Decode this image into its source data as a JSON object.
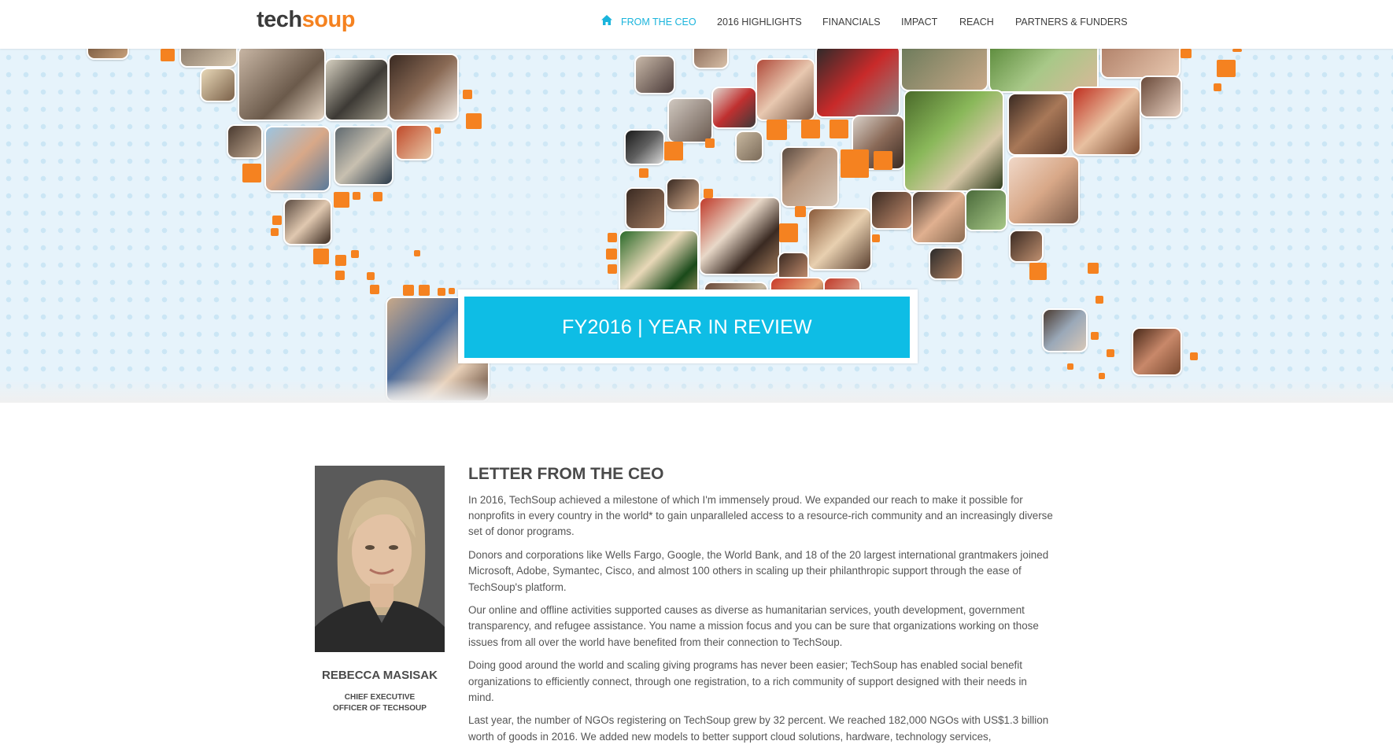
{
  "header": {
    "logo_part1": "tech",
    "logo_part2": "soup",
    "nav": [
      {
        "label": "FROM THE CEO",
        "active": true
      },
      {
        "label": "2016 HIGHLIGHTS"
      },
      {
        "label": "FINANCIALS"
      },
      {
        "label": "IMPACT"
      },
      {
        "label": "REACH"
      },
      {
        "label": "PARTNERS & FUNDERS"
      }
    ],
    "home_icon": "home-icon"
  },
  "hero": {
    "banner_text": "FY2016 | YEAR IN REVIEW",
    "colors": {
      "background": "#e6f3fb",
      "accent_square": "#f58220",
      "banner": "#0ebde5"
    }
  },
  "ceo": {
    "name": "REBECCA MASISAK",
    "title_line1": "CHIEF EXECUTIVE",
    "title_line2": "OFFICER OF TECHSOUP"
  },
  "letter": {
    "title": "LETTER FROM THE CEO",
    "paragraphs": [
      "In 2016, TechSoup achieved a milestone of which I'm immensely proud. We expanded our reach to make it possible for nonprofits in every country in the world* to gain unparalleled access to a resource-rich community and an increasingly diverse set of donor programs.",
      "Donors and corporations like Wells Fargo, Google, the World Bank, and 18 of the 20 largest international grantmakers joined Microsoft, Adobe, Symantec, Cisco, and almost 100 others in scaling up their philanthropic support through the ease of TechSoup's platform.",
      "Our online and offline activities supported causes as diverse as humanitarian services, youth development, government transparency, and refugee assistance. You name a mission focus and you can be sure that organizations working on those issues from all over the world have benefited from their connection to TechSoup.",
      "Doing good around the world and scaling giving programs has never been easier; TechSoup has enabled social benefit organizations to efficiently connect, through one registration, to a rich community of support designed with their needs in mind.",
      "Last year, the number of NGOs registering on TechSoup grew by 32 percent. We reached 182,000 NGOs with US$1.3 billion worth of goods in 2016. We added new models to better support cloud solutions, hardware, technology services,"
    ]
  }
}
